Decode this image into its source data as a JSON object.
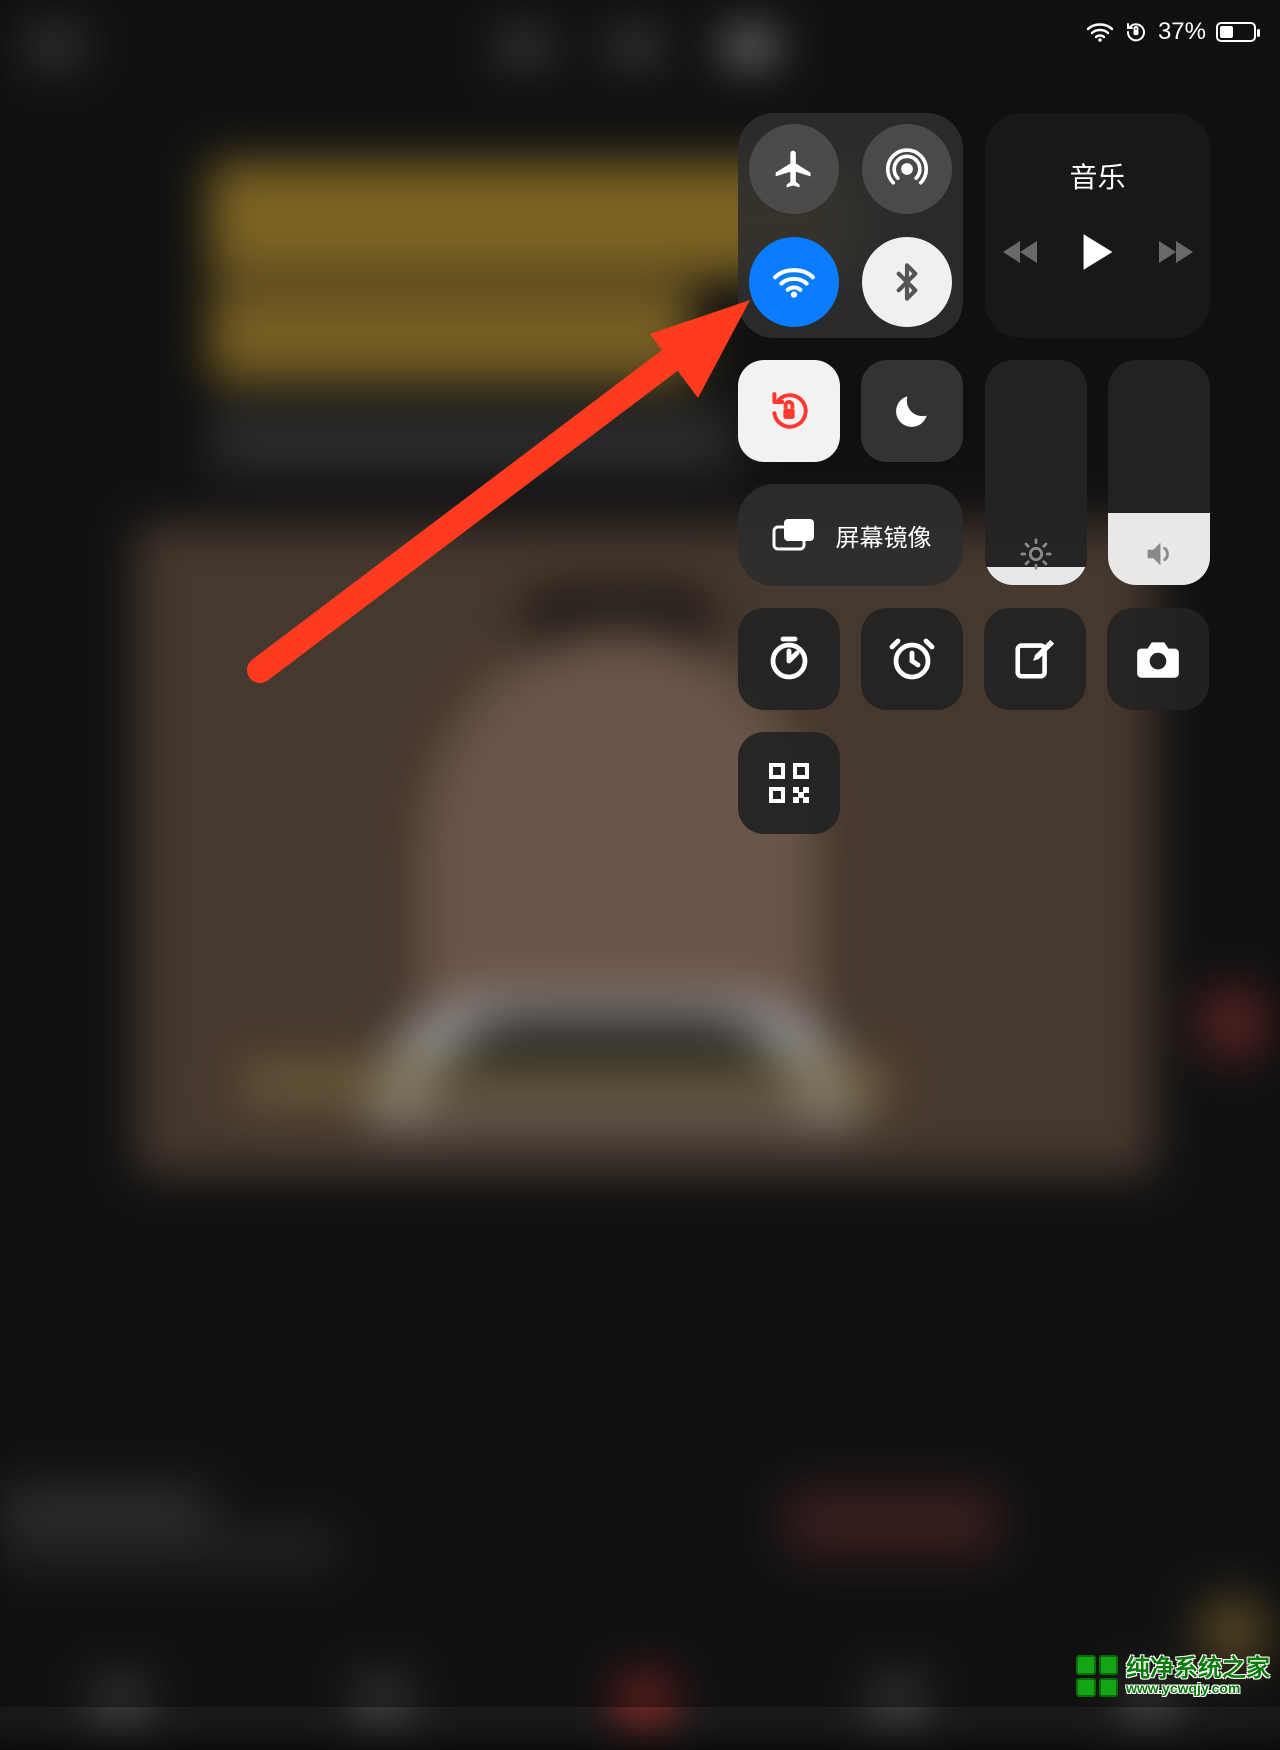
{
  "status": {
    "battery_percent": "37%",
    "orientation_locked": true,
    "wifi_connected": true
  },
  "control_center": {
    "connectivity": {
      "airplane": {
        "icon": "airplane-icon",
        "on": false
      },
      "airdrop": {
        "icon": "airdrop-icon",
        "on": false
      },
      "wifi": {
        "icon": "wifi-icon",
        "on": true
      },
      "bluetooth": {
        "icon": "bluetooth-icon",
        "on": true
      }
    },
    "music": {
      "title": "音乐",
      "prev_icon": "rewind-icon",
      "play_icon": "play-icon",
      "next_icon": "fastforward-icon"
    },
    "orientation_lock": {
      "icon": "orientation-lock-icon",
      "active": true
    },
    "do_not_disturb": {
      "icon": "moon-icon",
      "active": false
    },
    "screen_mirroring": {
      "icon": "screen-mirroring-icon",
      "label": "屏幕镜像"
    },
    "brightness": {
      "icon": "brightness-icon",
      "level_pct": 8
    },
    "volume": {
      "icon": "volume-icon",
      "level_pct": 32
    },
    "shortcuts": [
      {
        "name": "timer",
        "icon": "timer-icon"
      },
      {
        "name": "alarm",
        "icon": "alarm-icon"
      },
      {
        "name": "notes",
        "icon": "compose-icon"
      },
      {
        "name": "camera",
        "icon": "camera-icon"
      }
    ],
    "qr_scan": {
      "icon": "qr-code-icon"
    }
  },
  "annotation": {
    "arrow_target": "orientation-lock-toggle",
    "arrow_color": "#ff3b1f"
  },
  "watermark": {
    "text": "纯净系统之家",
    "url": "www.ycwqjy.com"
  }
}
